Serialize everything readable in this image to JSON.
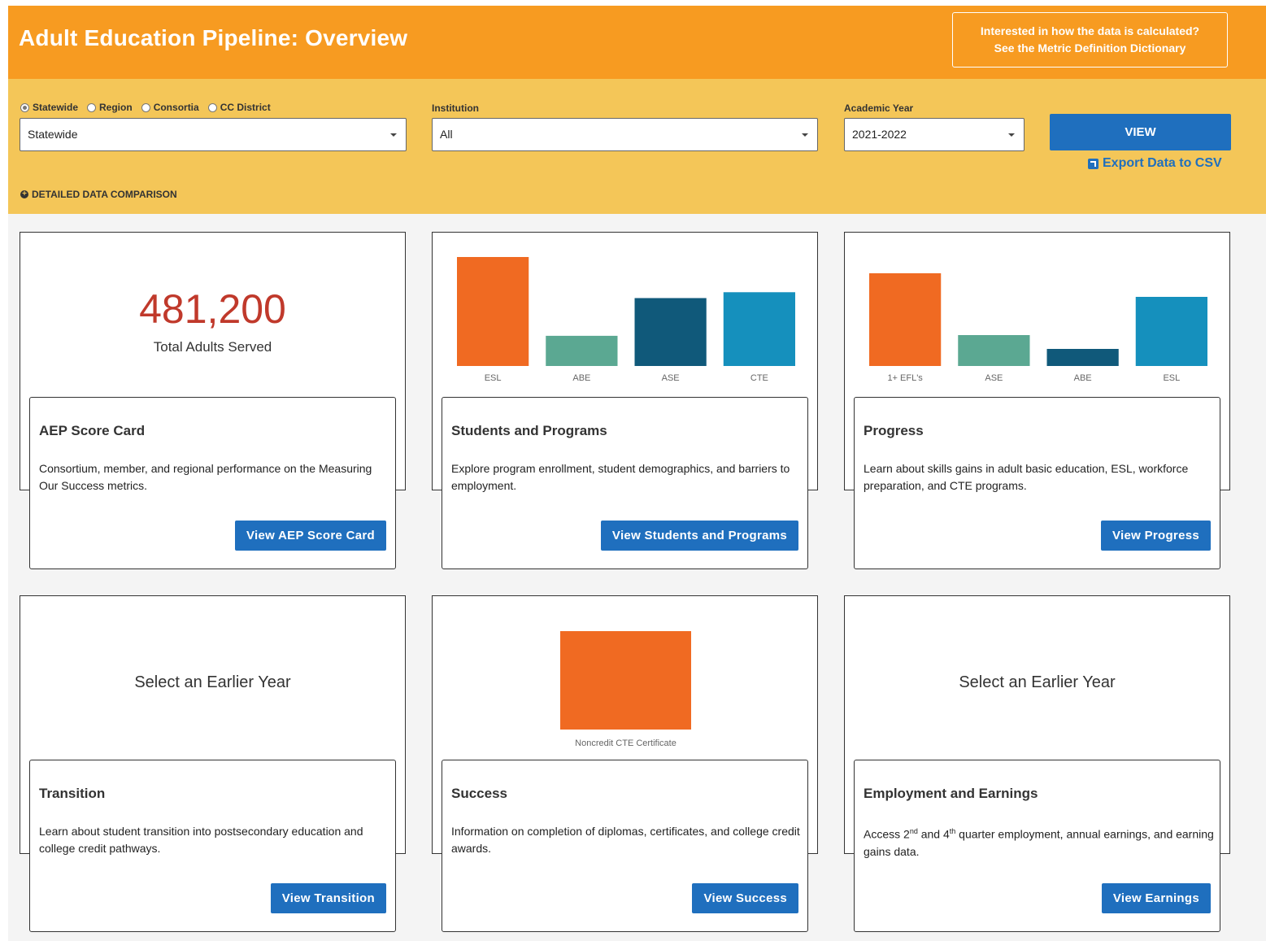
{
  "header": {
    "title": "Adult Education Pipeline: Overview",
    "dictionary_line1": "Interested in how the data is calculated?",
    "dictionary_line2": "See the Metric Definition Dictionary"
  },
  "filters": {
    "geo_options": [
      {
        "label": "Statewide",
        "selected": true
      },
      {
        "label": "Region",
        "selected": false
      },
      {
        "label": "Consortia",
        "selected": false
      },
      {
        "label": "CC District",
        "selected": false
      }
    ],
    "geo_value": "Statewide",
    "institution_label": "Institution",
    "institution_value": "All",
    "year_label": "Academic Year",
    "year_value": "2021-2022",
    "view_label": "VIEW",
    "export_label": "Export Data to CSV",
    "detail_label": "DETAILED DATA COMPARISON"
  },
  "scorecard": {
    "total": "481,200",
    "total_label": "Total Adults Served",
    "title": "AEP Score Card",
    "desc": "Consortium, member, and regional performance on the Measuring Our Success metrics.",
    "button": "View AEP Score Card"
  },
  "students": {
    "title": "Students and Programs",
    "desc": "Explore program enrollment, student demographics, and barriers to employment.",
    "button": "View Students and Programs"
  },
  "progress": {
    "title": "Progress",
    "desc": "Learn about skills gains in adult basic education, ESL, workforce preparation, and CTE programs.",
    "button": "View Progress"
  },
  "transition": {
    "placeholder": "Select an Earlier Year",
    "title": "Transition",
    "desc": "Learn about student transition into postsecondary education and college credit pathways.",
    "button": "View Transition"
  },
  "success": {
    "title": "Success",
    "desc": "Information on completion of diplomas, certificates, and college credit awards.",
    "button": "View Success"
  },
  "employment": {
    "placeholder": "Select an Earlier Year",
    "title": "Employment and Earnings",
    "desc_pre": "Access 2",
    "desc_sup1": "nd",
    "desc_mid": " and 4",
    "desc_sup2": "th",
    "desc_post": " quarter employment, annual earnings, and earning gains data.",
    "button": "View Earnings"
  },
  "colors": {
    "orange": "#f06a22",
    "green": "#5ba892",
    "navy": "#10597a",
    "teal": "#1590bd"
  },
  "chart_data": [
    {
      "type": "bar",
      "categories": [
        "ESL",
        "ABE",
        "ASE",
        "CTE"
      ],
      "values": [
        130,
        36,
        81,
        88
      ],
      "colors": [
        "#f06a22",
        "#5ba892",
        "#10597a",
        "#1590bd"
      ],
      "ylim": [
        0,
        130
      ]
    },
    {
      "type": "bar",
      "categories": [
        "1+ EFL's",
        "ASE",
        "ABE",
        "ESL"
      ],
      "values": [
        114,
        38,
        21,
        85
      ],
      "colors": [
        "#f06a22",
        "#5ba892",
        "#10597a",
        "#1590bd"
      ],
      "ylim": [
        0,
        114
      ]
    },
    {
      "type": "bar",
      "categories": [
        "Noncredit CTE Certificate"
      ],
      "values": [
        121
      ],
      "colors": [
        "#f06a22"
      ],
      "ylim": [
        0,
        121
      ]
    }
  ]
}
